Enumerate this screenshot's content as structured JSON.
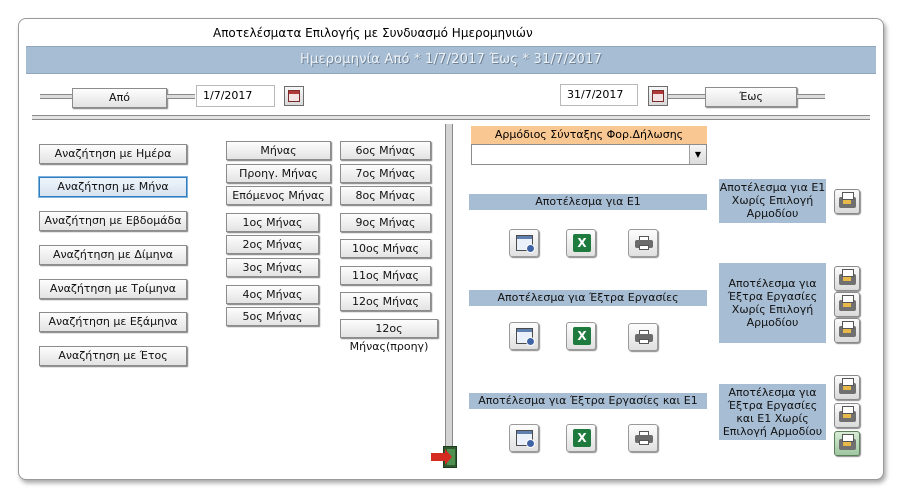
{
  "title": "Αποτελέσματα Επιλογής με Συνδυασμό Ημερομηνιών",
  "header_text": "Ημερομηνία  Από * 1/7/2017 Έως * 31/7/2017",
  "from": {
    "label": "Από",
    "date": "1/7/2017"
  },
  "to": {
    "label": "Έως",
    "date": "31/7/2017"
  },
  "search_buttons": [
    "Αναζήτηση με Ημέρα",
    "Αναζήτηση με Μήνα",
    "Αναζήτηση με Εβδομάδα",
    "Αναζήτηση με Δίμηνα",
    "Αναζήτηση με Τρίμηνα",
    "Αναζήτηση με Εξάμηνα",
    "Αναζήτηση με Έτος"
  ],
  "month_col1": [
    "Μήνας",
    "Προηγ. Μήνας",
    "Επόμενος Μήνας",
    "1ος Μήνας",
    "2ος Μήνας",
    "3ος Μήνας",
    "4ος Μήνας",
    "5ος Μήνας"
  ],
  "month_col2": [
    "6ος Μήνας",
    "7ος Μήνας",
    "8ος Μήνας",
    "9ος Μήνας",
    "10ος Μήνας",
    "11ος Μήνας",
    "12ος Μήνας",
    "12ος Μήνας(προηγ)"
  ],
  "responsible_label": "Αρμόδιος Σύνταξης Φορ.Δήλωσης",
  "responsible_value": "",
  "sections": [
    {
      "label": "Αποτέλεσμα για Ε1",
      "side": "Αποτέλεσμα για Ε1 Χωρίς Επιλογή Αρμοδίου"
    },
    {
      "label": "Αποτέλεσμα για Έξτρα Εργασίες",
      "side": "Αποτέλεσμα για Έξτρα Εργασίες Χωρίς Επιλογή Αρμοδίου"
    },
    {
      "label": "Αποτέλεσμα για Έξτρα Εργασίες και Ε1",
      "side": "Αποτέλεσμα για Έξτρα Εργασίες και Ε1 Χωρίς Επιλογή Αρμοδίου"
    }
  ],
  "icons": {
    "calendar": "calendar-icon",
    "excel": "excel-icon",
    "print": "print-icon",
    "exit": "exit-icon"
  },
  "excel_letter": "X"
}
